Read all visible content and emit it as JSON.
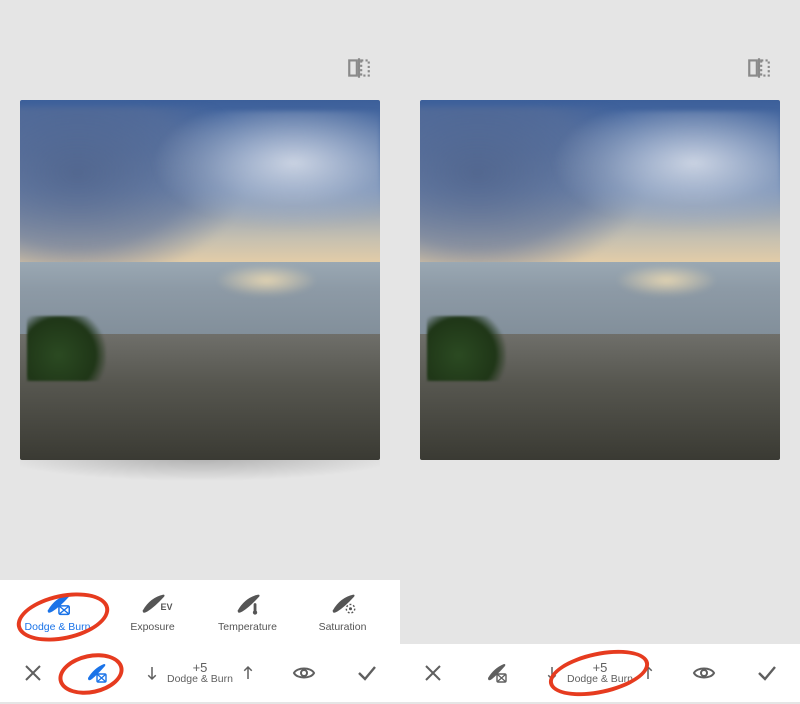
{
  "left": {
    "tools": [
      {
        "id": "dodge-burn",
        "label": "Dodge & Burn",
        "active": true
      },
      {
        "id": "exposure",
        "label": "Exposure",
        "sub": "EV"
      },
      {
        "id": "temperature",
        "label": "Temperature"
      },
      {
        "id": "saturation",
        "label": "Saturation"
      }
    ],
    "stepper": {
      "value": "+5",
      "label": "Dodge & Burn"
    }
  },
  "right": {
    "stepper": {
      "value": "+5",
      "label": "Dodge & Burn"
    }
  },
  "colors": {
    "accent": "#1a73e8",
    "annotation": "#e63b1f",
    "icon_gray": "#5f5f5f"
  },
  "icons": {
    "compare": "compare-icon",
    "close": "close-icon",
    "brush": "brush-icon",
    "eye": "eye-icon",
    "check": "check-icon",
    "arrow_up": "arrow-up-icon",
    "arrow_down": "arrow-down-icon"
  }
}
